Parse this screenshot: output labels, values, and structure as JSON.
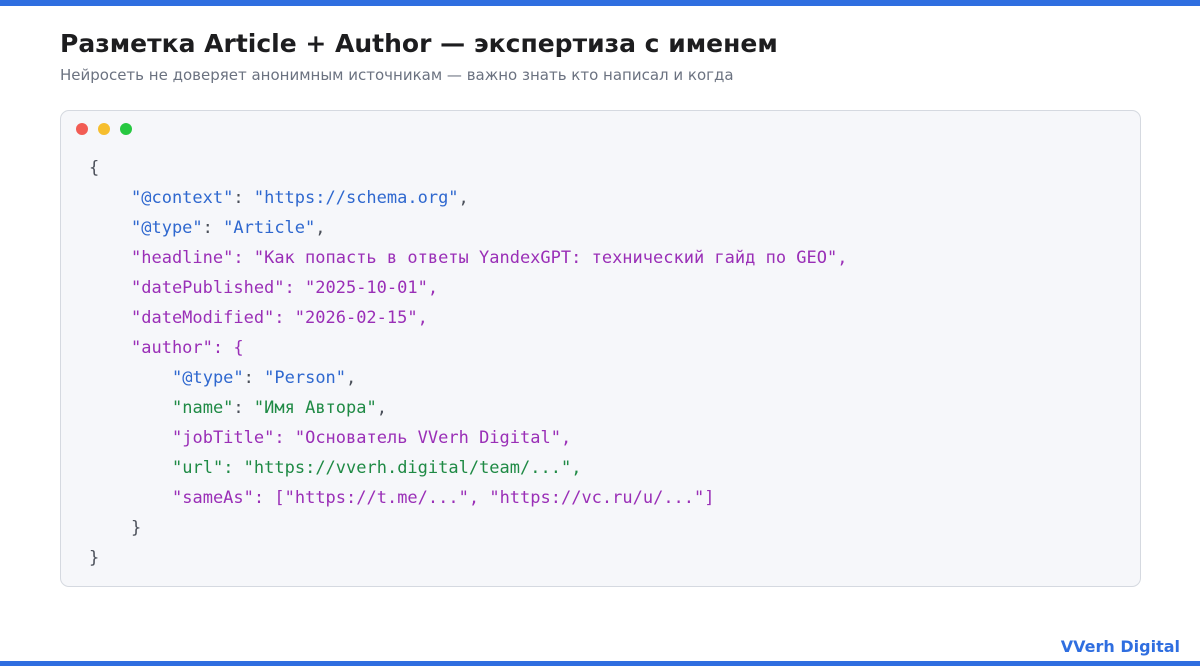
{
  "header": {
    "title": "Разметка Article + Author — экспертиза с именем",
    "subtitle": "Нейросеть не доверяет анонимным источникам — важно знать кто написал и когда"
  },
  "code": {
    "open_brace": "{",
    "close_brace": "}",
    "context_key": "\"@context\"",
    "context_value": "\"https://schema.org\"",
    "type_key": "\"@type\"",
    "type_value": "\"Article\"",
    "headline_key": "\"headline\"",
    "headline_value": "\"Как попасть в ответы YandexGPT: технический гайд по GEO\"",
    "date_published_key": "\"datePublished\"",
    "date_published_value": "\"2025-10-01\"",
    "date_modified_key": "\"dateModified\"",
    "date_modified_value": "\"2026-02-15\"",
    "author_key": "\"author\"",
    "author": {
      "open_brace": "{",
      "close_brace": "}",
      "type_key": "\"@type\"",
      "type_value": "\"Person\"",
      "name_key": "\"name\"",
      "name_value": "\"Имя Автора\"",
      "job_title_key": "\"jobTitle\"",
      "job_title_value": "\"Основатель VVerh Digital\"",
      "url_key": "\"url\"",
      "url_value": "\"https://vverh.digital/team/...\"",
      "same_as_key": "\"sameAs\"",
      "same_as_value_1": "\"https://t.me/...\"",
      "same_as_value_2": "\"https://vc.ru/u/...\""
    }
  },
  "footer": {
    "brand": "VVerh Digital"
  },
  "colors": {
    "accent": "#2f6ee0",
    "key_blue": "#2f68cf",
    "key_purple": "#9a2fb7",
    "key_green": "#1f8a45",
    "window_dot_red": "#f25c54",
    "window_dot_yellow": "#f6be2e",
    "window_dot_green": "#27c840"
  }
}
